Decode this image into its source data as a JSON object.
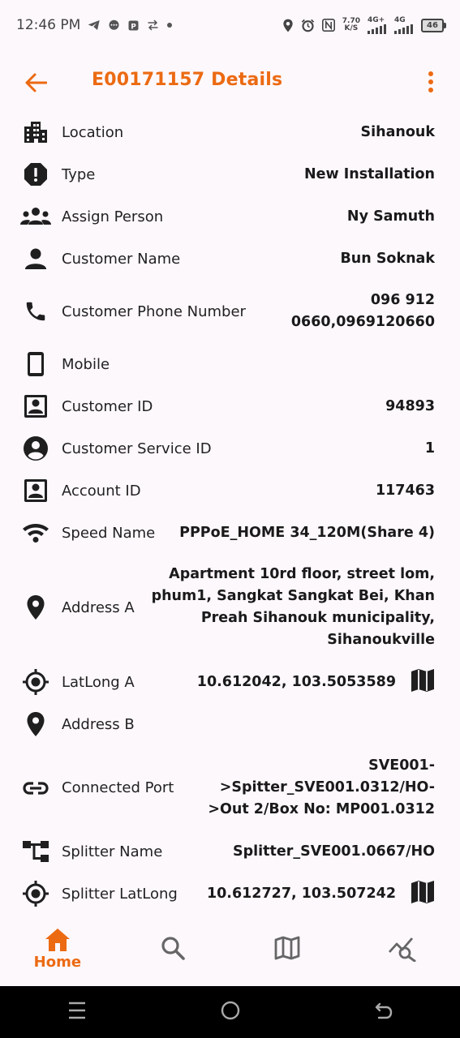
{
  "status_bar": {
    "time": "12:46 PM",
    "net_speed_value": "7.70",
    "net_speed_unit": "K/S",
    "net1": "4G+",
    "net2": "4G",
    "battery": "46"
  },
  "app_bar": {
    "title": "E00171157 Details"
  },
  "details": [
    {
      "icon": "building-icon",
      "label": "Location",
      "value": "Sihanouk"
    },
    {
      "icon": "alert-icon",
      "label": "Type",
      "value": "New Installation"
    },
    {
      "icon": "group-icon",
      "label": "Assign Person",
      "value": "Ny Samuth"
    },
    {
      "icon": "person-icon",
      "label": "Customer Name",
      "value": "Bun Soknak"
    },
    {
      "icon": "phone-icon",
      "label": "Customer Phone Number",
      "value_lines": [
        "096 912",
        "0660,0969120660"
      ]
    },
    {
      "icon": "mobile-icon",
      "label": "Mobile",
      "value": ""
    },
    {
      "icon": "id-card-icon",
      "label": "Customer ID",
      "value": "94893"
    },
    {
      "icon": "account-circle-icon",
      "label": "Customer Service ID",
      "value": "1"
    },
    {
      "icon": "id-card-icon",
      "label": "Account ID",
      "value": "117463"
    },
    {
      "icon": "wifi-icon",
      "label": "Speed Name",
      "value": "PPPoE_HOME 34_120M(Share 4)"
    },
    {
      "icon": "pin-icon",
      "label": "Address A",
      "value_lines": [
        "Apartment 10rd floor, street lom,",
        "phum1, Sangkat Sangkat Bei, Khan",
        "Preah Sihanouk municipality,",
        "Sihanoukville"
      ]
    },
    {
      "icon": "crosshair-icon",
      "label": "LatLong A",
      "value": "10.612042, 103.5053589"
    },
    {
      "icon": "pin-icon",
      "label": "Address B",
      "value": ""
    },
    {
      "icon": "link-icon",
      "label": "Connected Port",
      "value_lines": [
        "SVE001-",
        ">Spitter_SVE001.0312/HO-",
        ">Out 2/Box No: MP001.0312"
      ]
    },
    {
      "icon": "splitter-icon",
      "label": "Splitter Name",
      "value": "Splitter_SVE001.0667/HO"
    },
    {
      "icon": "crosshair-icon",
      "label": "Splitter LatLong",
      "value": "10.612727, 103.507242"
    }
  ],
  "bottom_nav": {
    "home_label": "Home"
  },
  "colors": {
    "accent": "#ec6a12",
    "background": "#fdf8fc",
    "system_nav": "#000000"
  }
}
